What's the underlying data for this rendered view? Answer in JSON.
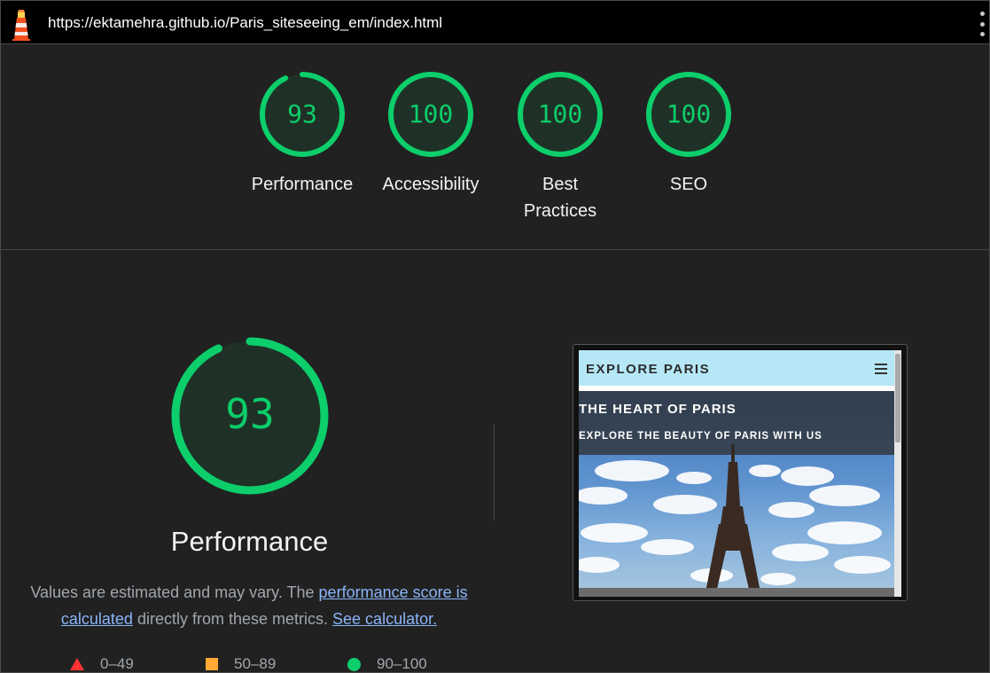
{
  "browser": {
    "url": "https://ektamehra.github.io/Paris_siteseeing_em/index.html",
    "logo_icon": "lighthouse-icon",
    "menu_icon": "kebab-menu-icon"
  },
  "categories": [
    {
      "label": "Performance",
      "score": "93",
      "fraction": 0.93
    },
    {
      "label": "Accessibility",
      "score": "100",
      "fraction": 1.0
    },
    {
      "label": "Best Practices",
      "score": "100",
      "fraction": 1.0
    },
    {
      "label": "SEO",
      "score": "100",
      "fraction": 1.0
    }
  ],
  "performance": {
    "score": "93",
    "fraction": 0.93,
    "title": "Performance",
    "desc_prefix": "Values are estimated and may vary. The",
    "link_score": "performance score is calculated",
    "desc_mid": "directly from these metrics.",
    "link_calc": "See calculator."
  },
  "legend": [
    {
      "range": "0–49",
      "shape": "triangle",
      "color": "#ff3333"
    },
    {
      "range": "50–89",
      "shape": "square",
      "color": "#ffaa33"
    },
    {
      "range": "90–100",
      "shape": "circle",
      "color": "#0cce6b"
    }
  ],
  "screenshot": {
    "brand": "EXPLORE PARIS",
    "hero_title": "THE HEART OF PARIS",
    "hero_subtitle": "EXPLORE THE BEAUTY OF PARIS WITH US",
    "menu_icon": "hamburger-icon"
  },
  "colors": {
    "pass": "#0cce6b",
    "average": "#ffaa33",
    "fail": "#ff3333",
    "background": "#212121",
    "link": "#8ab4f8"
  }
}
